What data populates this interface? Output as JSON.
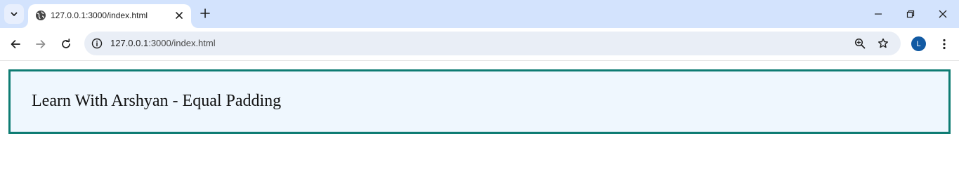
{
  "tab": {
    "title": "127.0.0.1:3000/index.html",
    "favicon": "globe-icon"
  },
  "toolbar": {
    "url_host": "127.0.0.1",
    "url_rest": ":3000/index.html",
    "profile_initial": "L"
  },
  "page": {
    "heading": "Learn With Arshyan - Equal Padding"
  },
  "colors": {
    "tabstrip": "#d3e3fd",
    "omnibox": "#e9eef6",
    "box_border": "#0e7c73",
    "box_background": "#eff7fe",
    "avatar": "#125aa3"
  }
}
